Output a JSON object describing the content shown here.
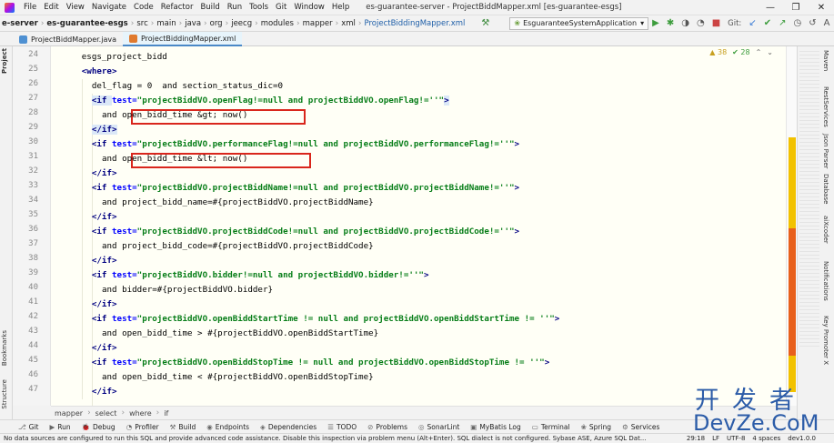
{
  "menubar": {
    "items": [
      "File",
      "Edit",
      "View",
      "Navigate",
      "Code",
      "Refactor",
      "Build",
      "Run",
      "Tools",
      "Git",
      "Window",
      "Help"
    ],
    "window_title": "es-guarantee-server - ProjectBiddMapper.xml [es-guarantee-esgs]",
    "min": "—",
    "max": "❐",
    "close": "✕"
  },
  "navbar": {
    "crumbs": [
      "e-server",
      "es-guarantee-esgs",
      "src",
      "main",
      "java",
      "org",
      "jeecg",
      "modules",
      "mapper",
      "xml",
      "ProjectBiddingMapper.xml"
    ],
    "run_config": "EsguaranteeSystemApplication",
    "git_label": "Git:"
  },
  "tabs": [
    {
      "label": "ProjectBiddMapper.java",
      "active": false
    },
    {
      "label": "ProjectBiddingMapper.xml",
      "active": true
    }
  ],
  "left_tools": [
    "Project",
    "Bookmarks",
    "Structure"
  ],
  "right_tools": [
    "Maven",
    "RestServices",
    "Json Parser",
    "Database",
    "aiXcoder",
    "Notifications",
    "Key Promoter X"
  ],
  "inspection": {
    "warnings": "▲ 38",
    "weak": "✔ 28",
    "up": "⌃",
    "down": "⌄"
  },
  "code": {
    "line_numbers": [
      "24",
      "25",
      "26",
      "27",
      "28",
      "29",
      "30",
      "31",
      "32",
      "33",
      "34",
      "35",
      "36",
      "37",
      "38",
      "39",
      "40",
      "41",
      "42",
      "43",
      "44",
      "45",
      "46",
      "47"
    ],
    "lines": [
      [
        {
          "t": "esgs_project_bidd",
          "c": "plain"
        }
      ],
      [
        {
          "t": "<",
          "c": "tag"
        },
        {
          "t": "where",
          "c": "tag"
        },
        {
          "t": ">",
          "c": "tag"
        }
      ],
      [
        {
          "t": "del_flag = 0  and section_status_dic=0",
          "c": "plain"
        }
      ],
      [
        {
          "t": "<",
          "c": "tag"
        },
        {
          "t": "if ",
          "c": "tag"
        },
        {
          "t": "test=",
          "c": "attr"
        },
        {
          "t": "\"projectBiddVO.openFlag!=null and projectBiddVO.openFlag!=''\"",
          "c": "val"
        },
        {
          "t": ">",
          "c": "tag"
        }
      ],
      [
        {
          "t": "and open_bidd_time &gt; now()",
          "c": "plain"
        }
      ],
      [
        {
          "t": "</",
          "c": "tag"
        },
        {
          "t": "if",
          "c": "tag"
        },
        {
          "t": ">",
          "c": "tag"
        }
      ],
      [
        {
          "t": "<",
          "c": "tag"
        },
        {
          "t": "if ",
          "c": "tag"
        },
        {
          "t": "test=",
          "c": "attr"
        },
        {
          "t": "\"projectBiddVO.performanceFlag!=null and projectBiddVO.performanceFlag!=''\"",
          "c": "val"
        },
        {
          "t": ">",
          "c": "tag"
        }
      ],
      [
        {
          "t": "and open_bidd_time &lt; now()",
          "c": "plain"
        }
      ],
      [
        {
          "t": "</",
          "c": "tag"
        },
        {
          "t": "if",
          "c": "tag"
        },
        {
          "t": ">",
          "c": "tag"
        }
      ],
      [
        {
          "t": "<",
          "c": "tag"
        },
        {
          "t": "if ",
          "c": "tag"
        },
        {
          "t": "test=",
          "c": "attr"
        },
        {
          "t": "\"projectBiddVO.projectBiddName!=null and projectBiddVO.projectBiddName!=''\"",
          "c": "val"
        },
        {
          "t": ">",
          "c": "tag"
        }
      ],
      [
        {
          "t": "and project_bidd_name=#{projectBiddVO.projectBiddName}",
          "c": "plain"
        }
      ],
      [
        {
          "t": "</",
          "c": "tag"
        },
        {
          "t": "if",
          "c": "tag"
        },
        {
          "t": ">",
          "c": "tag"
        }
      ],
      [
        {
          "t": "<",
          "c": "tag"
        },
        {
          "t": "if ",
          "c": "tag"
        },
        {
          "t": "test=",
          "c": "attr"
        },
        {
          "t": "\"projectBiddVO.projectBiddCode!=null and projectBiddVO.projectBiddCode!=''\"",
          "c": "val"
        },
        {
          "t": ">",
          "c": "tag"
        }
      ],
      [
        {
          "t": "and project_bidd_code=#{projectBiddVO.projectBiddCode}",
          "c": "plain"
        }
      ],
      [
        {
          "t": "</",
          "c": "tag"
        },
        {
          "t": "if",
          "c": "tag"
        },
        {
          "t": ">",
          "c": "tag"
        }
      ],
      [
        {
          "t": "<",
          "c": "tag"
        },
        {
          "t": "if ",
          "c": "tag"
        },
        {
          "t": "test=",
          "c": "attr"
        },
        {
          "t": "\"projectBiddVO.bidder!=null and projectBiddVO.bidder!=''\"",
          "c": "val"
        },
        {
          "t": ">",
          "c": "tag"
        }
      ],
      [
        {
          "t": "and bidder=#{projectBiddVO.bidder}",
          "c": "plain"
        }
      ],
      [
        {
          "t": "</",
          "c": "tag"
        },
        {
          "t": "if",
          "c": "tag"
        },
        {
          "t": ">",
          "c": "tag"
        }
      ],
      [
        {
          "t": "<",
          "c": "tag"
        },
        {
          "t": "if ",
          "c": "tag"
        },
        {
          "t": "test=",
          "c": "attr"
        },
        {
          "t": "\"projectBiddVO.openBiddStartTime != null and projectBiddVO.openBiddStartTime != ''\"",
          "c": "val"
        },
        {
          "t": ">",
          "c": "tag"
        }
      ],
      [
        {
          "t": "and open_bidd_time > #{projectBiddVO.openBiddStartTime}",
          "c": "plain"
        }
      ],
      [
        {
          "t": "</",
          "c": "tag"
        },
        {
          "t": "if",
          "c": "tag"
        },
        {
          "t": ">",
          "c": "tag"
        }
      ],
      [
        {
          "t": "<",
          "c": "tag"
        },
        {
          "t": "if ",
          "c": "tag"
        },
        {
          "t": "test=",
          "c": "attr"
        },
        {
          "t": "\"projectBiddVO.openBiddStopTime != null and projectBiddVO.openBiddStopTime != ''\"",
          "c": "val"
        },
        {
          "t": ">",
          "c": "tag"
        }
      ],
      [
        {
          "t": "and open_bidd_time < #{projectBiddVO.openBiddStopTime}",
          "c": "plain"
        }
      ],
      [
        {
          "t": "</",
          "c": "tag"
        },
        {
          "t": "if",
          "c": "tag"
        },
        {
          "t": ">",
          "c": "tag"
        }
      ]
    ]
  },
  "breadcrumb": [
    "mapper",
    "select",
    "where",
    "if"
  ],
  "tool_windows": [
    {
      "icon": "⎇",
      "label": "Git"
    },
    {
      "icon": "▶",
      "label": "Run"
    },
    {
      "icon": "🐞",
      "label": "Debug"
    },
    {
      "icon": "◔",
      "label": "Profiler"
    },
    {
      "icon": "⚒",
      "label": "Build"
    },
    {
      "icon": "◉",
      "label": "Endpoints"
    },
    {
      "icon": "◈",
      "label": "Dependencies"
    },
    {
      "icon": "☰",
      "label": "TODO"
    },
    {
      "icon": "⊘",
      "label": "Problems"
    },
    {
      "icon": "◎",
      "label": "SonarLint"
    },
    {
      "icon": "▣",
      "label": "MyBatis Log"
    },
    {
      "icon": "▭",
      "label": "Terminal"
    },
    {
      "icon": "❀",
      "label": "Spring"
    },
    {
      "icon": "⚙",
      "label": "Services"
    }
  ],
  "status": {
    "message": "No data sources are configured to run this SQL and provide advanced code assistance. Disable this inspection via problem menu (Alt+Enter). SQL dialect is not configured. Sybase ASE, Azure SQL Dat...",
    "position": "29:18",
    "line_sep": "LF",
    "encoding": "UTF-8",
    "indent": "4 spaces",
    "branch": "dev1.0.0"
  },
  "watermark": {
    "cn": "开发者",
    "en": "DevZe.CoM"
  }
}
